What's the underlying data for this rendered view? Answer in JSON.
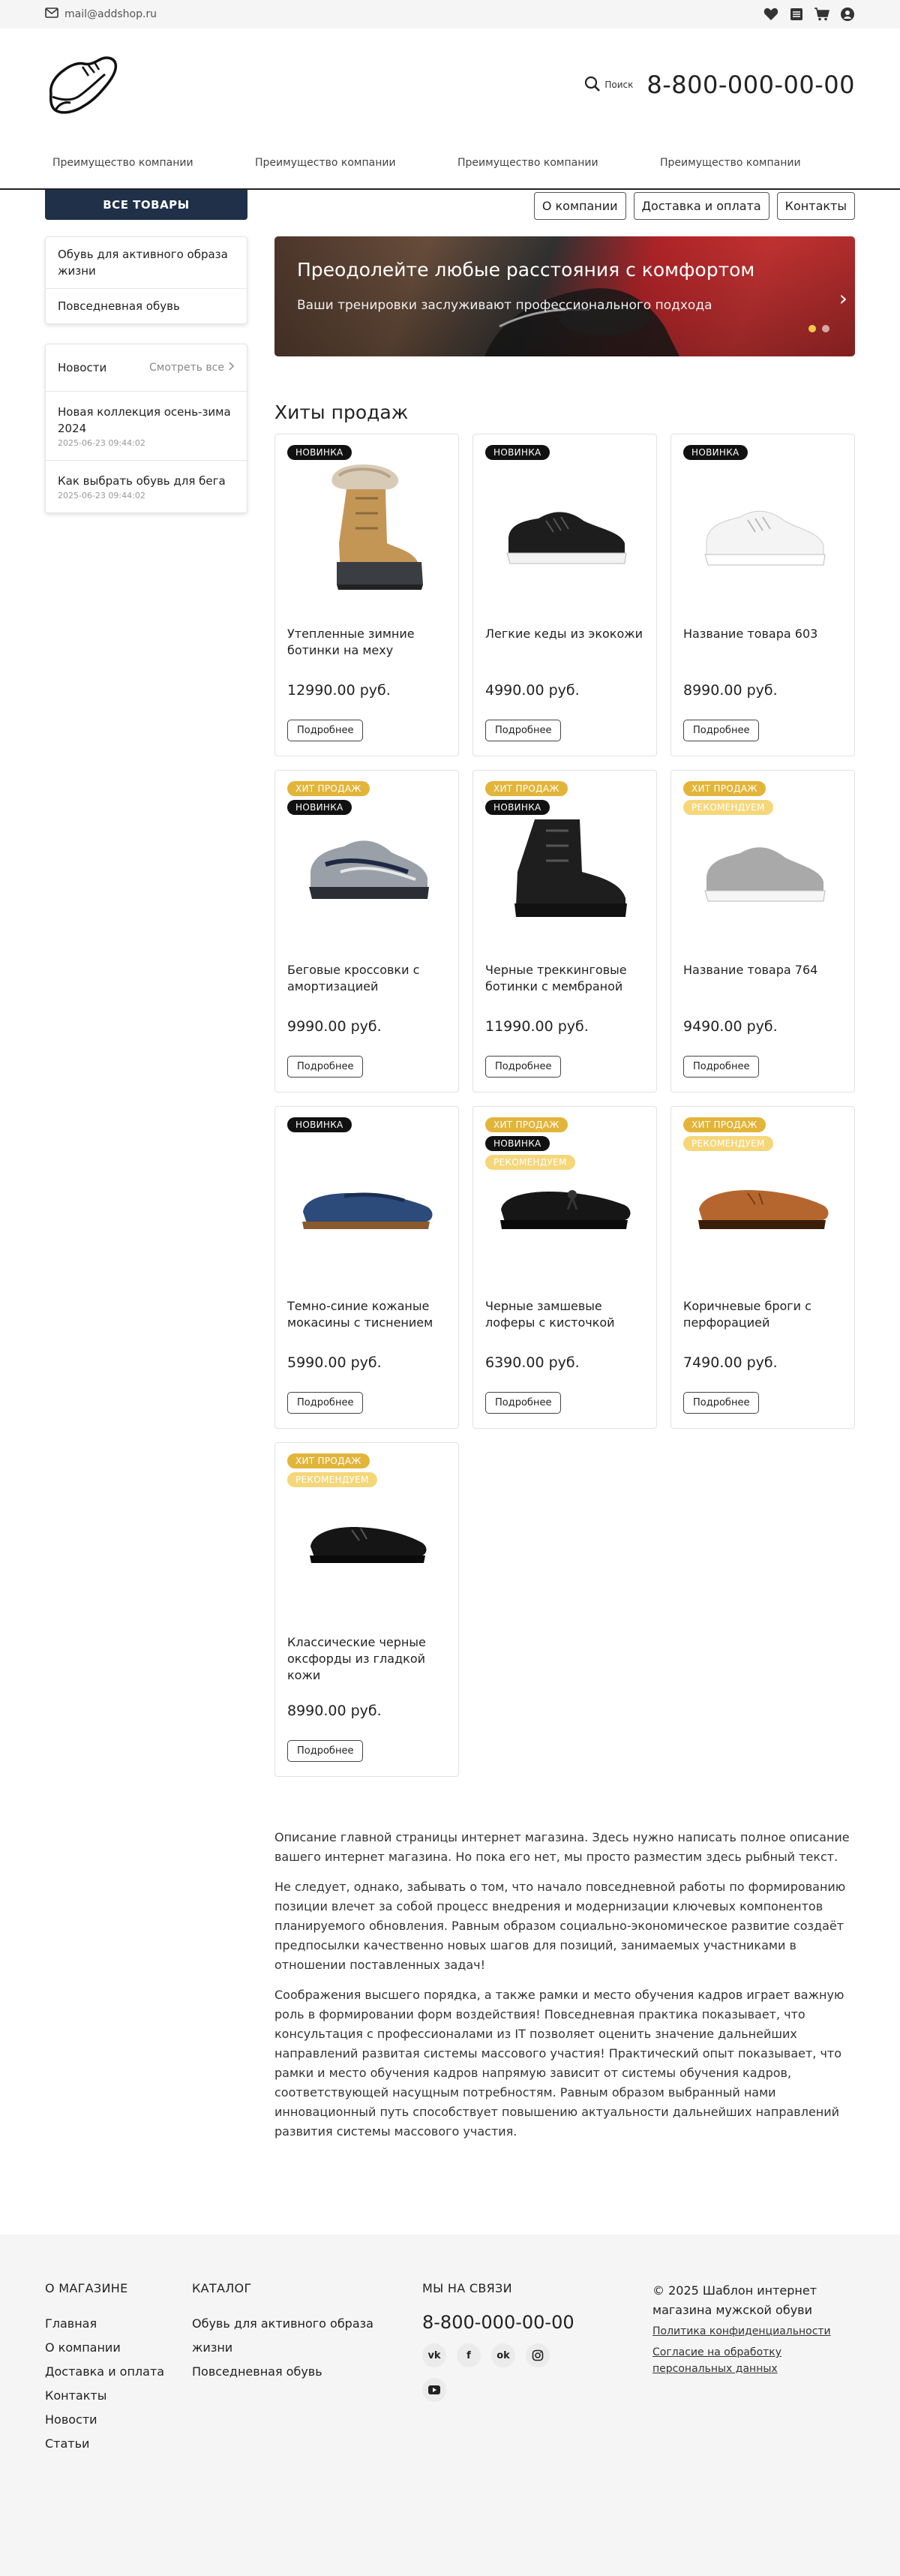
{
  "topbar": {
    "email": "mail@addshop.ru",
    "icons": [
      "heart-icon",
      "compare-icon",
      "cart-icon",
      "user-icon"
    ]
  },
  "header": {
    "search_label": "Поиск",
    "phone": "8-800-000-00-00"
  },
  "nav": {
    "items": [
      "Преимущество компании",
      "Преимущество компании",
      "Преимущество компании",
      "Преимущество компании"
    ]
  },
  "sidebar": {
    "all_goods": "ВСЕ ТОВАРЫ",
    "categories": [
      "Обувь для активного образа жизни",
      "Повседневная обувь"
    ],
    "news": {
      "title": "Новости",
      "see_all": "Смотреть все",
      "items": [
        {
          "title": "Новая коллекция осень-зима 2024",
          "date": "2025-06-23 09:44:02"
        },
        {
          "title": "Как выбрать обувь для бега",
          "date": "2025-06-23 09:44:02"
        }
      ]
    }
  },
  "top_buttons": [
    "О компании",
    "Доставка и оплата",
    "Контакты"
  ],
  "banner": {
    "title": "Преодолейте любые расстояния с комфортом",
    "subtitle": "Ваши тренировки заслуживают профессионального подхода"
  },
  "badges": {
    "new": "НОВИНКА",
    "hit": "ХИТ ПРОДАЖ",
    "rec": "РЕКОМЕНДУЕМ"
  },
  "hits": {
    "title": "Хиты продаж",
    "more_label": "Подробнее",
    "products": [
      {
        "name": "Утепленные зимние ботинки на меху",
        "price": "12990.00 руб."
      },
      {
        "name": "Легкие кеды из экокожи",
        "price": "4990.00 руб."
      },
      {
        "name": "Название товара 603",
        "price": "8990.00 руб."
      },
      {
        "name": "Беговые кроссовки с амортизацией",
        "price": "9990.00 руб."
      },
      {
        "name": "Черные треккинговые ботинки с мембраной",
        "price": "11990.00 руб."
      },
      {
        "name": "Название товара 764",
        "price": "9490.00 руб."
      },
      {
        "name": "Темно-синие кожаные мокасины с тиснением",
        "price": "5990.00 руб."
      },
      {
        "name": "Черные замшевые лоферы с кисточкой",
        "price": "6390.00 руб."
      },
      {
        "name": "Коричневые броги с перфорацией",
        "price": "7490.00 руб."
      },
      {
        "name": "Классические черные оксфорды из гладкой кожи",
        "price": "8990.00 руб."
      }
    ]
  },
  "about": {
    "paragraphs": [
      "Описание главной страницы интернет магазина. Здесь нужно написать полное описание вашего интернет магазина. Но пока его нет, мы просто разместим здесь рыбный текст.",
      "Не следует, однако, забывать о том, что начало повседневной работы по формированию позиции влечет за собой процесс внедрения и модернизации ключевых компонентов планируемого обновления. Равным образом социально-экономическое развитие создаёт предпосылки качественно новых шагов для позиций, занимаемых участниками в отношении поставленных задач!",
      "Соображения высшего порядка, а также рамки и место обучения кадров играет важную роль в формировании форм воздействия! Повседневная практика показывает, что консультация с профессионалами из IT позволяет оценить значение дальнейших направлений развитая системы массового участия! Практический опыт показывает, что рамки и место обучения кадров напрямую зависит от системы обучения кадров, соответствующей насущным потребностям. Равным образом выбранный нами инновационный путь способствует повышению актуальности дальнейших направлений развития системы массового участия."
    ]
  },
  "footer": {
    "about_title": "О МАГАЗИНЕ",
    "about_links": [
      "Главная",
      "О компании",
      "Доставка и оплата",
      "Контакты",
      "Новости",
      "Статьи"
    ],
    "catalog_title": "КАТАЛОГ",
    "catalog_links": [
      "Обувь для активного образа жизни",
      "Повседневная обувь"
    ],
    "contact_title": "МЫ НА СВЯЗИ",
    "phone": "8-800-000-00-00",
    "socials": [
      "vk-icon",
      "facebook-icon",
      "odnoklassniki-icon",
      "instagram-icon",
      "youtube-icon"
    ],
    "copyright": "© 2025 Шаблон интернет магазина мужской обуви",
    "privacy": "Политика конфиденциальности",
    "consent": "Согласие на обработку персональных данных"
  }
}
